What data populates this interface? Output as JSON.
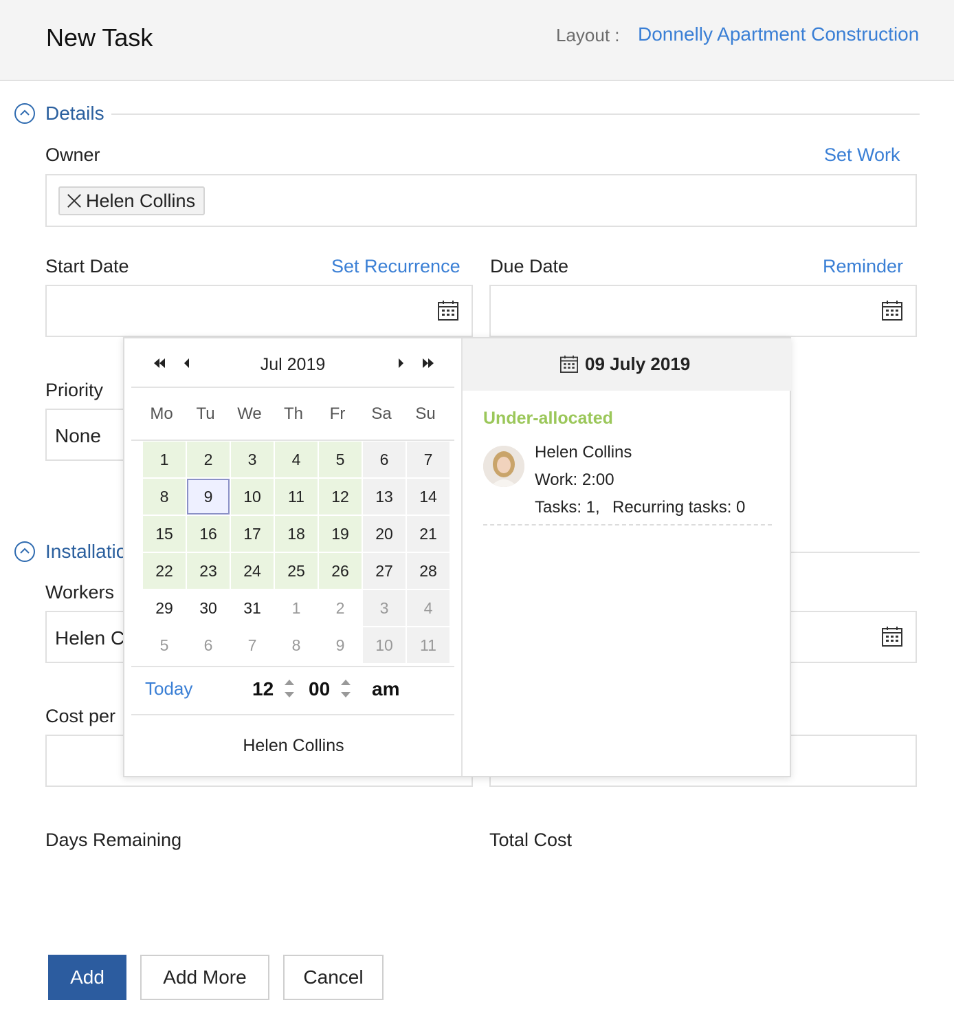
{
  "header": {
    "title": "New Task",
    "layout_label": "Layout :",
    "layout_value": "Donnelly Apartment Construction"
  },
  "sections": {
    "details": "Details",
    "installation": "Installatio"
  },
  "owner": {
    "label": "Owner",
    "set_work": "Set Work",
    "chip": "Helen Collins"
  },
  "start_date": {
    "label": "Start Date",
    "link": "Set Recurrence",
    "value": ""
  },
  "due_date": {
    "label": "Due Date",
    "link": "Reminder",
    "value": ""
  },
  "priority": {
    "label": "Priority",
    "value": "None"
  },
  "workers": {
    "label": "Workers",
    "value": "Helen C"
  },
  "cost_per": {
    "label": "Cost per"
  },
  "days_remaining": {
    "label": "Days Remaining"
  },
  "total_cost": {
    "label": "Total Cost"
  },
  "calendar": {
    "month_label": "Jul 2019",
    "weekdays": [
      "Mo",
      "Tu",
      "We",
      "Th",
      "Fr",
      "Sa",
      "Su"
    ],
    "days": [
      {
        "d": "1",
        "t": "green"
      },
      {
        "d": "2",
        "t": "green"
      },
      {
        "d": "3",
        "t": "green"
      },
      {
        "d": "4",
        "t": "green"
      },
      {
        "d": "5",
        "t": "green"
      },
      {
        "d": "6",
        "t": "gray"
      },
      {
        "d": "7",
        "t": "gray"
      },
      {
        "d": "8",
        "t": "green"
      },
      {
        "d": "9",
        "t": "selected"
      },
      {
        "d": "10",
        "t": "green"
      },
      {
        "d": "11",
        "t": "green"
      },
      {
        "d": "12",
        "t": "green"
      },
      {
        "d": "13",
        "t": "gray"
      },
      {
        "d": "14",
        "t": "gray"
      },
      {
        "d": "15",
        "t": "green"
      },
      {
        "d": "16",
        "t": "green"
      },
      {
        "d": "17",
        "t": "green"
      },
      {
        "d": "18",
        "t": "green"
      },
      {
        "d": "19",
        "t": "green"
      },
      {
        "d": "20",
        "t": "gray"
      },
      {
        "d": "21",
        "t": "gray"
      },
      {
        "d": "22",
        "t": "green"
      },
      {
        "d": "23",
        "t": "green"
      },
      {
        "d": "24",
        "t": "green"
      },
      {
        "d": "25",
        "t": "green"
      },
      {
        "d": "26",
        "t": "green"
      },
      {
        "d": "27",
        "t": "gray"
      },
      {
        "d": "28",
        "t": "gray"
      },
      {
        "d": "29",
        "t": "plain"
      },
      {
        "d": "30",
        "t": "plain"
      },
      {
        "d": "31",
        "t": "plain"
      },
      {
        "d": "1",
        "t": "dim"
      },
      {
        "d": "2",
        "t": "dim"
      },
      {
        "d": "3",
        "t": "dimgray"
      },
      {
        "d": "4",
        "t": "dimgray"
      },
      {
        "d": "5",
        "t": "dim"
      },
      {
        "d": "6",
        "t": "dim"
      },
      {
        "d": "7",
        "t": "dim"
      },
      {
        "d": "8",
        "t": "dim"
      },
      {
        "d": "9",
        "t": "dim"
      },
      {
        "d": "10",
        "t": "dimgray"
      },
      {
        "d": "11",
        "t": "dimgray"
      }
    ],
    "today": "Today",
    "hour": "12",
    "minute": "00",
    "ampm": "am",
    "footer_owner": "Helen Collins"
  },
  "allocation": {
    "date": "09 July 2019",
    "status": "Under-allocated",
    "name": "Helen Collins",
    "work": "Work: 2:00",
    "tasks": "Tasks: 1,",
    "recurring": "Recurring tasks: 0"
  },
  "buttons": {
    "add": "Add",
    "add_more": "Add More",
    "cancel": "Cancel"
  },
  "colors": {
    "accent": "#3a7fd5",
    "primary_button": "#2c5c9f",
    "under_allocated": "#9bc75a",
    "working_day": "#eaf4e0"
  }
}
